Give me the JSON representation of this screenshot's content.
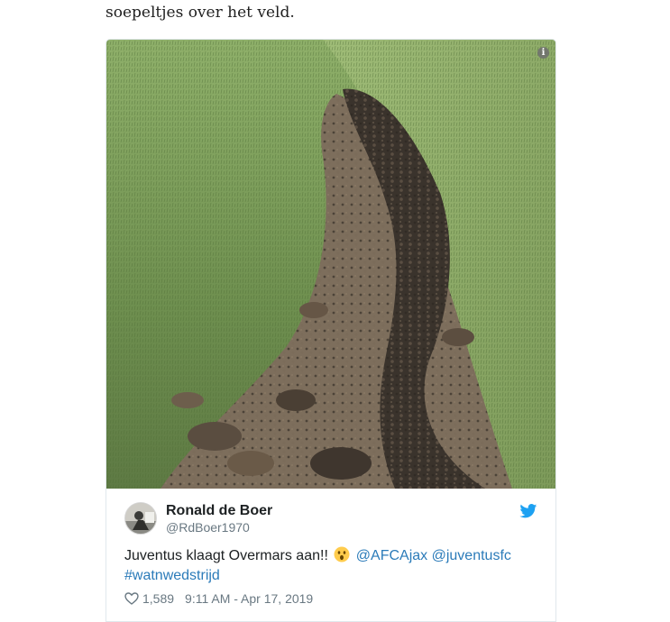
{
  "article": {
    "text": "soepeltjes over het veld."
  },
  "tweet": {
    "author_name": "Ronald de Boer",
    "author_handle": "@RdBoer1970",
    "text_before_emoji": "Juventus klaagt Overmars aan!! ",
    "mention_1": "@AFCAjax",
    "mention_2": "@juventusfc",
    "hashtag": "#watnwedstrijd",
    "likes": "1,589",
    "timestamp": "9:11 AM - Apr 17, 2019",
    "emoji": "astonished-face",
    "link_color": "#2b7bb9",
    "brand_color": "#1da1f2"
  },
  "media": {
    "info_label": "i"
  }
}
